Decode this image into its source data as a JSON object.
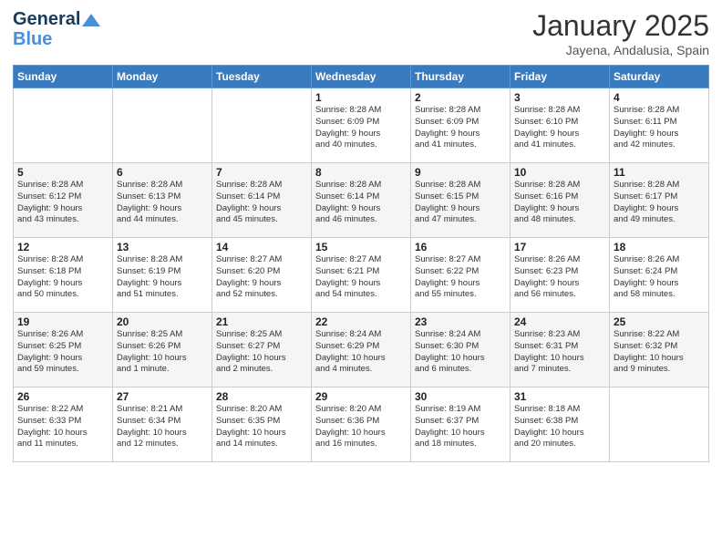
{
  "header": {
    "logo_line1": "General",
    "logo_line2": "Blue",
    "month_title": "January 2025",
    "location": "Jayena, Andalusia, Spain"
  },
  "calendar": {
    "days_of_week": [
      "Sunday",
      "Monday",
      "Tuesday",
      "Wednesday",
      "Thursday",
      "Friday",
      "Saturday"
    ],
    "weeks": [
      [
        {
          "day": "",
          "info": ""
        },
        {
          "day": "",
          "info": ""
        },
        {
          "day": "",
          "info": ""
        },
        {
          "day": "1",
          "info": "Sunrise: 8:28 AM\nSunset: 6:09 PM\nDaylight: 9 hours\nand 40 minutes."
        },
        {
          "day": "2",
          "info": "Sunrise: 8:28 AM\nSunset: 6:09 PM\nDaylight: 9 hours\nand 41 minutes."
        },
        {
          "day": "3",
          "info": "Sunrise: 8:28 AM\nSunset: 6:10 PM\nDaylight: 9 hours\nand 41 minutes."
        },
        {
          "day": "4",
          "info": "Sunrise: 8:28 AM\nSunset: 6:11 PM\nDaylight: 9 hours\nand 42 minutes."
        }
      ],
      [
        {
          "day": "5",
          "info": "Sunrise: 8:28 AM\nSunset: 6:12 PM\nDaylight: 9 hours\nand 43 minutes."
        },
        {
          "day": "6",
          "info": "Sunrise: 8:28 AM\nSunset: 6:13 PM\nDaylight: 9 hours\nand 44 minutes."
        },
        {
          "day": "7",
          "info": "Sunrise: 8:28 AM\nSunset: 6:14 PM\nDaylight: 9 hours\nand 45 minutes."
        },
        {
          "day": "8",
          "info": "Sunrise: 8:28 AM\nSunset: 6:14 PM\nDaylight: 9 hours\nand 46 minutes."
        },
        {
          "day": "9",
          "info": "Sunrise: 8:28 AM\nSunset: 6:15 PM\nDaylight: 9 hours\nand 47 minutes."
        },
        {
          "day": "10",
          "info": "Sunrise: 8:28 AM\nSunset: 6:16 PM\nDaylight: 9 hours\nand 48 minutes."
        },
        {
          "day": "11",
          "info": "Sunrise: 8:28 AM\nSunset: 6:17 PM\nDaylight: 9 hours\nand 49 minutes."
        }
      ],
      [
        {
          "day": "12",
          "info": "Sunrise: 8:28 AM\nSunset: 6:18 PM\nDaylight: 9 hours\nand 50 minutes."
        },
        {
          "day": "13",
          "info": "Sunrise: 8:28 AM\nSunset: 6:19 PM\nDaylight: 9 hours\nand 51 minutes."
        },
        {
          "day": "14",
          "info": "Sunrise: 8:27 AM\nSunset: 6:20 PM\nDaylight: 9 hours\nand 52 minutes."
        },
        {
          "day": "15",
          "info": "Sunrise: 8:27 AM\nSunset: 6:21 PM\nDaylight: 9 hours\nand 54 minutes."
        },
        {
          "day": "16",
          "info": "Sunrise: 8:27 AM\nSunset: 6:22 PM\nDaylight: 9 hours\nand 55 minutes."
        },
        {
          "day": "17",
          "info": "Sunrise: 8:26 AM\nSunset: 6:23 PM\nDaylight: 9 hours\nand 56 minutes."
        },
        {
          "day": "18",
          "info": "Sunrise: 8:26 AM\nSunset: 6:24 PM\nDaylight: 9 hours\nand 58 minutes."
        }
      ],
      [
        {
          "day": "19",
          "info": "Sunrise: 8:26 AM\nSunset: 6:25 PM\nDaylight: 9 hours\nand 59 minutes."
        },
        {
          "day": "20",
          "info": "Sunrise: 8:25 AM\nSunset: 6:26 PM\nDaylight: 10 hours\nand 1 minute."
        },
        {
          "day": "21",
          "info": "Sunrise: 8:25 AM\nSunset: 6:27 PM\nDaylight: 10 hours\nand 2 minutes."
        },
        {
          "day": "22",
          "info": "Sunrise: 8:24 AM\nSunset: 6:29 PM\nDaylight: 10 hours\nand 4 minutes."
        },
        {
          "day": "23",
          "info": "Sunrise: 8:24 AM\nSunset: 6:30 PM\nDaylight: 10 hours\nand 6 minutes."
        },
        {
          "day": "24",
          "info": "Sunrise: 8:23 AM\nSunset: 6:31 PM\nDaylight: 10 hours\nand 7 minutes."
        },
        {
          "day": "25",
          "info": "Sunrise: 8:22 AM\nSunset: 6:32 PM\nDaylight: 10 hours\nand 9 minutes."
        }
      ],
      [
        {
          "day": "26",
          "info": "Sunrise: 8:22 AM\nSunset: 6:33 PM\nDaylight: 10 hours\nand 11 minutes."
        },
        {
          "day": "27",
          "info": "Sunrise: 8:21 AM\nSunset: 6:34 PM\nDaylight: 10 hours\nand 12 minutes."
        },
        {
          "day": "28",
          "info": "Sunrise: 8:20 AM\nSunset: 6:35 PM\nDaylight: 10 hours\nand 14 minutes."
        },
        {
          "day": "29",
          "info": "Sunrise: 8:20 AM\nSunset: 6:36 PM\nDaylight: 10 hours\nand 16 minutes."
        },
        {
          "day": "30",
          "info": "Sunrise: 8:19 AM\nSunset: 6:37 PM\nDaylight: 10 hours\nand 18 minutes."
        },
        {
          "day": "31",
          "info": "Sunrise: 8:18 AM\nSunset: 6:38 PM\nDaylight: 10 hours\nand 20 minutes."
        },
        {
          "day": "",
          "info": ""
        }
      ]
    ]
  }
}
